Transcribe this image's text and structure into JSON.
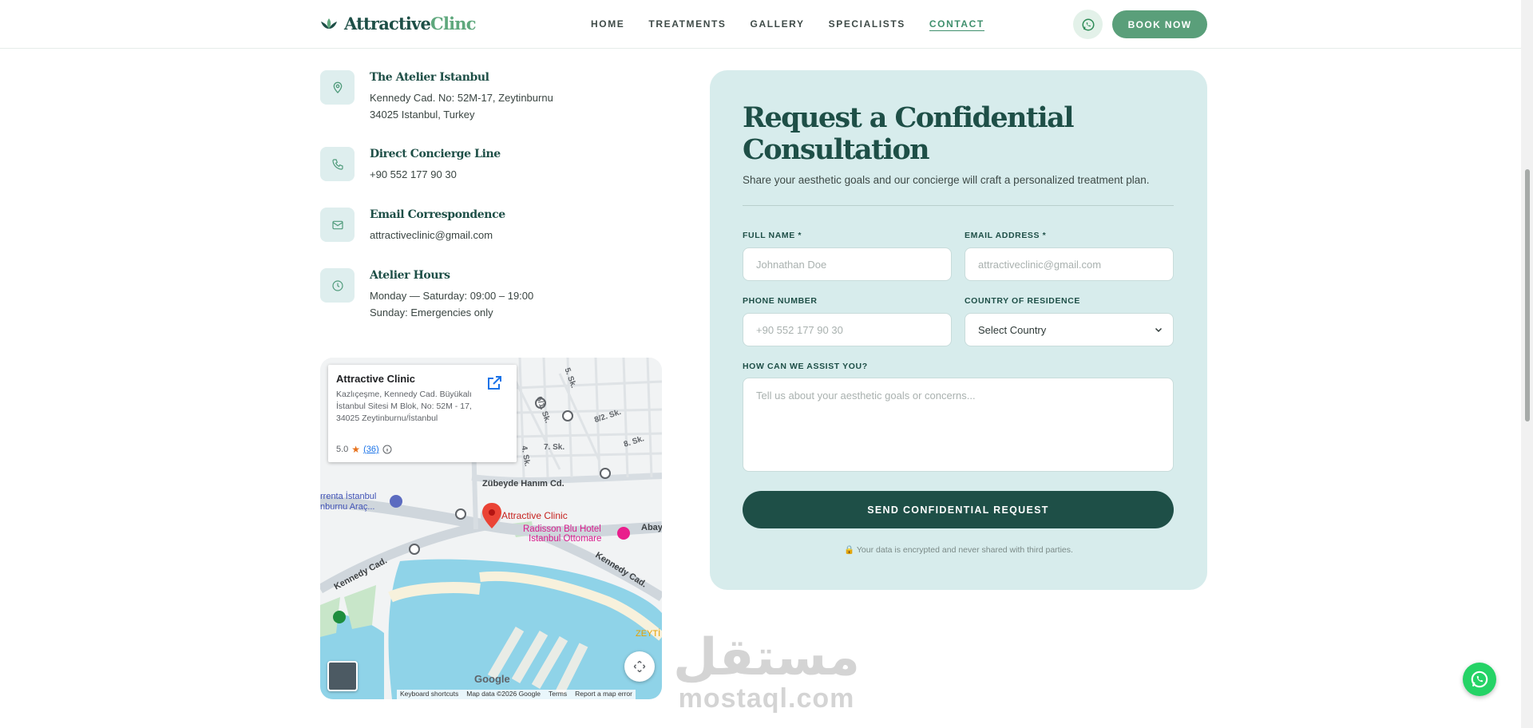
{
  "header": {
    "logo_part1": "Attractive",
    "logo_part2": "Clinc",
    "nav": [
      {
        "label": "HOME"
      },
      {
        "label": "TREATMENTS"
      },
      {
        "label": "GALLERY"
      },
      {
        "label": "SPECIALISTS"
      },
      {
        "label": "CONTACT",
        "active": true
      }
    ],
    "book_label": "BOOK NOW"
  },
  "contact": {
    "address": {
      "title": "The Atelier Istanbul",
      "line1": "Kennedy Cad. No: 52M-17, Zeytinburnu",
      "line2": "34025 Istanbul, Turkey",
      "icon": "location-pin-icon"
    },
    "phone": {
      "title": "Direct Concierge Line",
      "line1": "+90 552 177 90 30",
      "icon": "phone-icon"
    },
    "email": {
      "title": "Email Correspondence",
      "line1": "attractiveclinic@gmail.com",
      "icon": "mail-icon"
    },
    "hours": {
      "title": "Atelier Hours",
      "line1": "Monday — Saturday: 09:00 – 19:00",
      "line2": "Sunday: Emergencies only",
      "icon": "clock-icon"
    }
  },
  "map": {
    "card_title": "Attractive Clinic",
    "card_address": "Kazlıçeşme, Kennedy Cad. Büyükalı İstanbul Sitesi M Blok, No: 52M - 17, 34025 Zeytinburnu/İstanbul",
    "rating": "5.0",
    "review_count": "(36)",
    "labels": {
      "pin": "Attractive Clinic",
      "hotel1": "Radisson Blu Hotel",
      "hotel2": "Istanbul Ottomare",
      "street1": "Zübeyde Hanım Cd.",
      "street2": "Kennedy Cad.",
      "street3": "Kennedy Cad.",
      "place1": "rrenta İstanbul",
      "place2": "nburnu Araç...",
      "abay": "Abay",
      "sk1": "5. Sk.",
      "sk2": "6/1. Sk.",
      "sk3": "8/2. Sk.",
      "sk4": "7. Sk.",
      "sk5": "8. Sk.",
      "sk6": "4. Sk.",
      "zeyt": "ZEYTİ"
    },
    "google": "Google",
    "footer": [
      "Keyboard shortcuts",
      "Map data ©2026 Google",
      "Terms",
      "Report a map error"
    ]
  },
  "form": {
    "title": "Request a Confidential Consultation",
    "subtitle": "Share your aesthetic goals and our concierge will craft a personalized treatment plan.",
    "full_name_label": "FULL NAME *",
    "full_name_placeholder": "Johnathan Doe",
    "email_label": "EMAIL ADDRESS *",
    "email_placeholder": "attractiveclinic@gmail.com",
    "phone_label": "PHONE NUMBER",
    "phone_placeholder": "+90 552 177 90 30",
    "country_label": "COUNTRY OF RESIDENCE",
    "country_value": "Select Country",
    "assist_label": "HOW CAN WE ASSIST YOU?",
    "assist_placeholder": "Tell us about your aesthetic goals or concerns...",
    "submit_label": "SEND CONFIDENTIAL REQUEST",
    "privacy_note": "Your data is encrypted and never shared with third parties."
  },
  "watermark": {
    "arabic": "مستقل",
    "latin": "mostaql.com"
  },
  "colors": {
    "brand_dark": "#1e4f47",
    "brand_green": "#5a9f7a",
    "panel_bg": "#d7ecec"
  }
}
